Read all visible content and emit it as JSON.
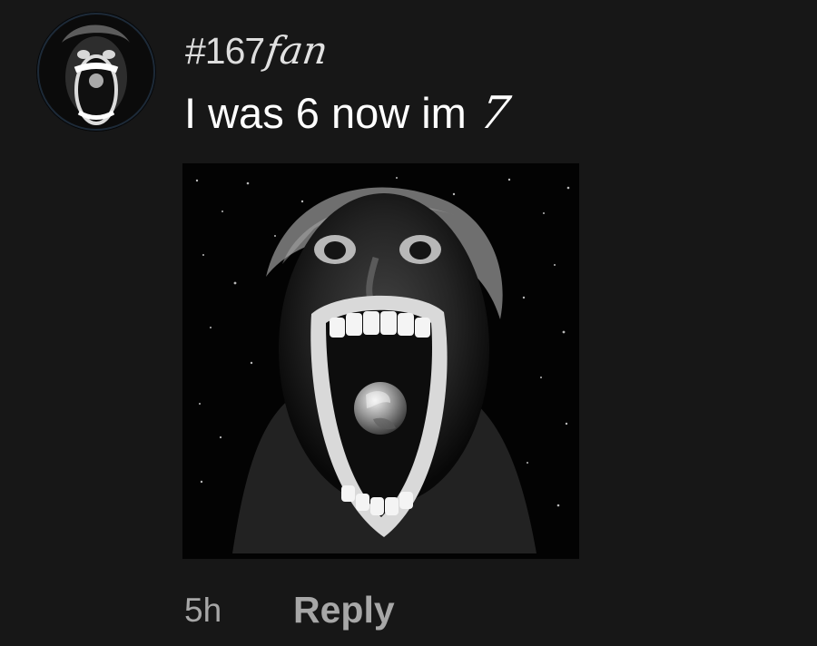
{
  "comment": {
    "avatar_icon": "screaming-face-avatar",
    "username_typed": "#167",
    "username_handwritten": "fan",
    "text_typed": "I was 6 now im",
    "text_handwritten": "7",
    "image_icon": "screaming-face-earth-in-mouth-image",
    "timestamp": "5h",
    "reply_label": "Reply"
  },
  "colors": {
    "background": "#171717",
    "text_primary": "#ffffff",
    "text_secondary": "#a7a7a7"
  }
}
